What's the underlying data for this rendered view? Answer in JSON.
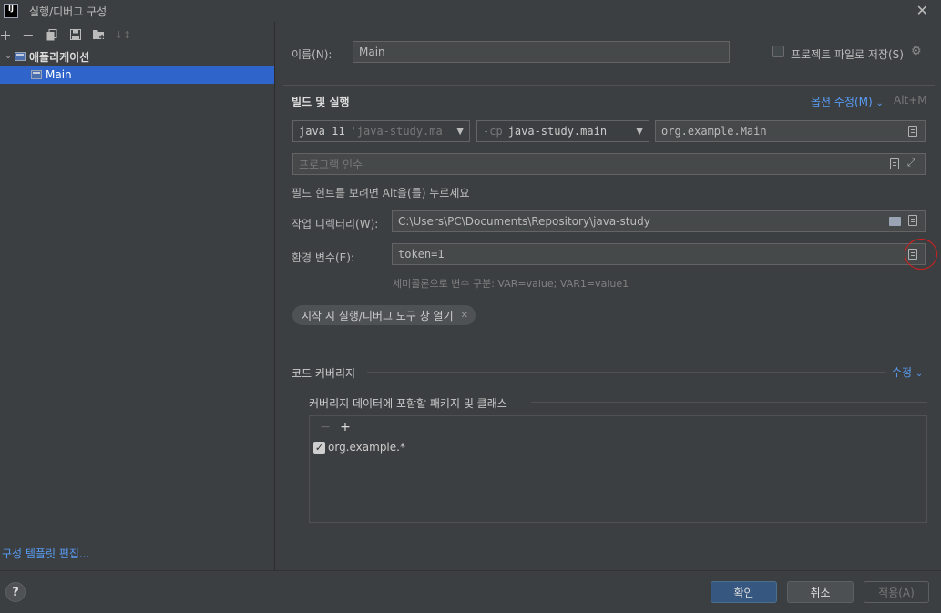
{
  "window": {
    "title": "실행/디버그 구성",
    "logo_text": "IJ",
    "close_icon": "close-icon"
  },
  "sidebar": {
    "toolbar": {
      "add": "+",
      "remove": "−",
      "copy_icon": "copy-icon",
      "save_icon": "save-icon",
      "folder_icon": "new-folder-icon",
      "sort_icon": "sort-icon"
    },
    "tree": {
      "group_label": "애플리케이션",
      "item_label": "Main"
    },
    "edit_templates": "구성 템플릿 편집..."
  },
  "form": {
    "name_label": "이름(N):",
    "name_value": "Main",
    "store_as_file_label": "프로젝트 파일로 저장(S)",
    "build_run": {
      "title": "빌드 및 실행",
      "modify_options": "옵션 수정(M)",
      "shortcut": "Alt+M",
      "jre_main": "java 11",
      "jre_sub": "'java-study.main'",
      "cp_prefix": "-cp",
      "cp_value": "java-study.main",
      "main_class": "org.example.Main",
      "program_args_placeholder": "프로그램 인수",
      "field_hint": "필드 힌트를 보려면 Alt을(를) 누르세요"
    },
    "working_dir_label": "작업 디렉터리(W):",
    "working_dir_value": "C:\\Users\\PC\\Documents\\Repository\\java-study",
    "env_label": "환경 변수(E):",
    "env_value": "token=1",
    "env_hint": "세미콜론으로 변수 구분: VAR=value; VAR1=value1",
    "chip_label": "시작 시 실행/디버그 도구 창 열기",
    "coverage": {
      "title": "코드 커버리지",
      "modify": "수정",
      "include_label": "커버리지 데이터에 포함할 패키지 및 클래스",
      "remove_tool": "−",
      "add_tool": "+",
      "packages": [
        "org.example.*"
      ]
    }
  },
  "footer": {
    "help": "?",
    "ok": "확인",
    "cancel": "취소",
    "apply": "적용(A)"
  },
  "colors": {
    "background": "#3c3f41",
    "selection": "#2f65ca",
    "link": "#589df6",
    "primary_button": "#365880",
    "annotation": "#d81e1e"
  }
}
